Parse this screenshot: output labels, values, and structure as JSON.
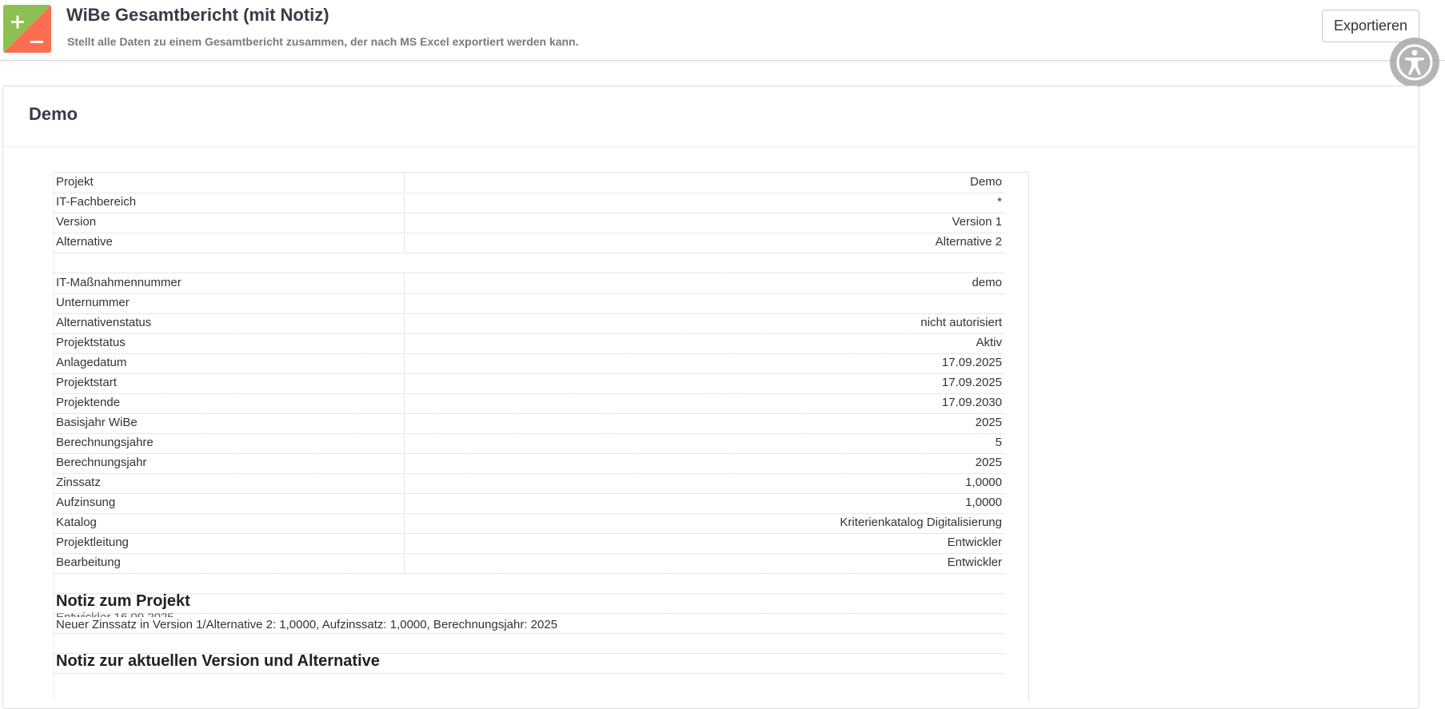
{
  "header": {
    "title": "WiBe Gesamtbericht (mit Notiz)",
    "subtitle": "Stellt alle Daten zu einem Gesamtbericht zusammen, der nach MS Excel exportiert werden kann.",
    "export_label": "Exportieren",
    "logo_icon": "plus-minus-icon",
    "accessibility_icon": "accessibility-icon",
    "colors": {
      "logo_green": "#8cc152",
      "logo_red": "#fc6e51"
    }
  },
  "panel": {
    "title": "Demo"
  },
  "report": {
    "group1": [
      {
        "label": "Projekt",
        "value": "Demo"
      },
      {
        "label": "IT-Fachbereich",
        "value": "*"
      },
      {
        "label": "Version",
        "value": "Version 1"
      },
      {
        "label": "Alternative",
        "value": "Alternative 2"
      }
    ],
    "group2": [
      {
        "label": "IT-Maßnahmennummer",
        "value": "demo"
      },
      {
        "label": "Unternummer",
        "value": ""
      },
      {
        "label": "Alternativenstatus",
        "value": "nicht autorisiert"
      },
      {
        "label": "Projektstatus",
        "value": "Aktiv"
      },
      {
        "label": "Anlagedatum",
        "value": "17.09.2025"
      },
      {
        "label": "Projektstart",
        "value": "17.09.2025"
      },
      {
        "label": "Projektende",
        "value": "17.09.2030"
      },
      {
        "label": "Basisjahr WiBe",
        "value": "2025"
      },
      {
        "label": "Berechnungsjahre",
        "value": "5"
      },
      {
        "label": "Berechnungsjahr",
        "value": "2025"
      },
      {
        "label": "Zinssatz",
        "value": "1,0000"
      },
      {
        "label": "Aufzinsung",
        "value": "1,0000"
      },
      {
        "label": "Katalog",
        "value": "Kriterienkatalog Digitalisierung"
      },
      {
        "label": "Projektleitung",
        "value": "Entwickler"
      },
      {
        "label": "Bearbeitung",
        "value": "Entwickler"
      }
    ],
    "note_project_heading": "Notiz zum Projekt",
    "note_project_author": "Entwickler 16.09.2025",
    "note_project_text": "Neuer Zinssatz in Version 1/Alternative 2: 1,0000, Aufzinssatz: 1,0000, Berechnungsjahr: 2025",
    "note_version_heading": "Notiz zur aktuellen Version und Alternative"
  }
}
